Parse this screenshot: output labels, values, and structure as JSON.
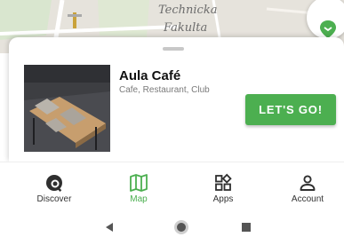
{
  "map": {
    "label_line1": "Technicka",
    "label_line2": "Fakulta",
    "marker_color": "#4caf50"
  },
  "venue": {
    "name": "Aula Café",
    "categories": "Cafe, Restaurant, Club",
    "cta_label": "LET'S GO!"
  },
  "nav": {
    "items": [
      {
        "label": "Discover",
        "icon": "discover-icon",
        "active": false
      },
      {
        "label": "Map",
        "icon": "map-icon",
        "active": true
      },
      {
        "label": "Apps",
        "icon": "apps-icon",
        "active": false
      },
      {
        "label": "Account",
        "icon": "account-icon",
        "active": false
      }
    ]
  },
  "system_bar": {
    "icons": [
      "back-icon",
      "home-icon",
      "recents-icon"
    ]
  },
  "colors": {
    "accent": "#4caf50",
    "text": "#111111",
    "subtext": "#7a7a7a",
    "map_background": "#e6e3dc"
  }
}
